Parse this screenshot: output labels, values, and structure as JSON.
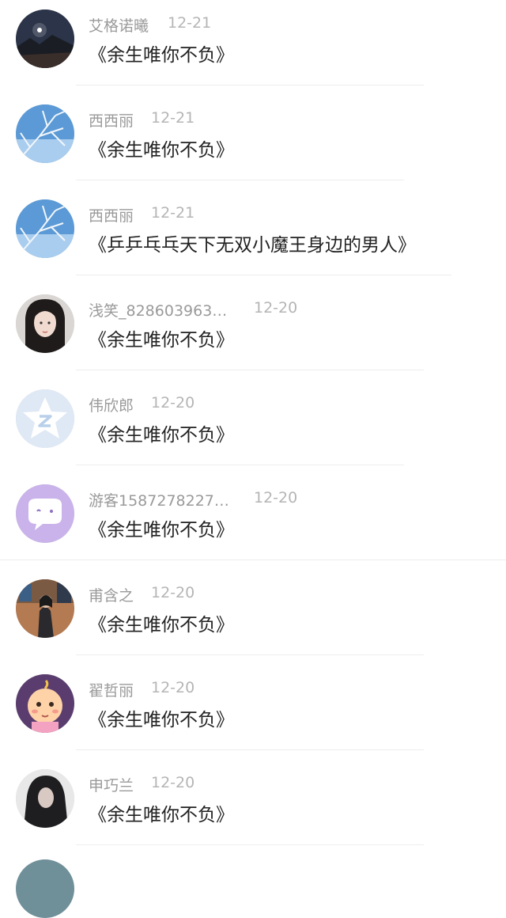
{
  "comments": [
    {
      "name": "艾格诺曦",
      "date": "12-21",
      "title": "《余生唯你不负》",
      "avatar_icon": "night-landscape-avatar"
    },
    {
      "name": "西西丽",
      "date": "12-21",
      "title": "《余生唯你不负》",
      "avatar_icon": "frost-branches-avatar"
    },
    {
      "name": "西西丽",
      "date": "12-21",
      "title": "《乒乒乓乓天下无双小魔王身边的男人》",
      "avatar_icon": "frost-branches-avatar"
    },
    {
      "name": "浅笑_828603963…",
      "date": "12-20",
      "title": "《余生唯你不负》",
      "avatar_icon": "portrait-girl-avatar"
    },
    {
      "name": "伟欣郎",
      "date": "12-20",
      "title": "《余生唯你不负》",
      "avatar_icon": "default-star-avatar"
    },
    {
      "name": "游客1587278227…",
      "date": "12-20",
      "title": "《余生唯你不负》",
      "avatar_icon": "chat-bubble-avatar"
    },
    {
      "name": "甫含之",
      "date": "12-20",
      "title": "《余生唯你不负》",
      "avatar_icon": "street-photo-avatar"
    },
    {
      "name": "翟哲丽",
      "date": "12-20",
      "title": "《余生唯你不负》",
      "avatar_icon": "cartoon-baby-avatar"
    },
    {
      "name": "申巧兰",
      "date": "12-20",
      "title": "《余生唯你不负》",
      "avatar_icon": "hooded-figure-avatar"
    }
  ],
  "colors": {
    "name": "#9a9a9a",
    "date": "#b5b5b5",
    "title": "#222222",
    "divider": "#ededed"
  }
}
